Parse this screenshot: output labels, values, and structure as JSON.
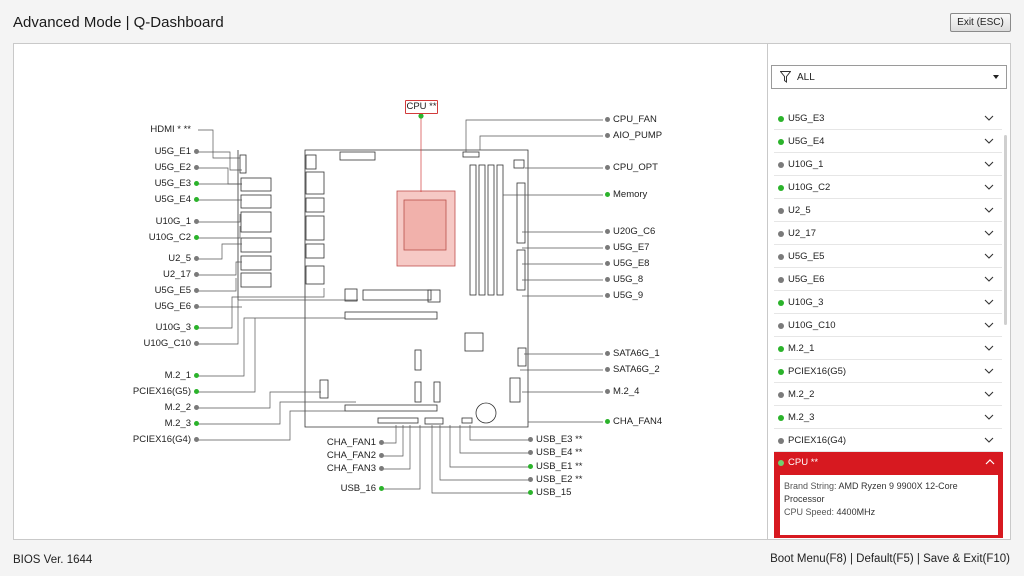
{
  "header": {
    "title": "Advanced Mode | Q-Dashboard",
    "exit_label": "Exit (ESC)"
  },
  "board": {
    "cpu_tag": "CPU **",
    "left_labels": [
      {
        "text": "HDMI * **",
        "status": "none"
      },
      {
        "text": "U5G_E1",
        "status": "grey"
      },
      {
        "text": "U5G_E2",
        "status": "grey"
      },
      {
        "text": "U5G_E3",
        "status": "green"
      },
      {
        "text": "U5G_E4",
        "status": "green"
      },
      {
        "text": "U10G_1",
        "status": "grey"
      },
      {
        "text": "U10G_C2",
        "status": "green"
      },
      {
        "text": "U2_5",
        "status": "grey"
      },
      {
        "text": "U2_17",
        "status": "grey"
      },
      {
        "text": "U5G_E5",
        "status": "grey"
      },
      {
        "text": "U5G_E6",
        "status": "grey"
      },
      {
        "text": "U10G_3",
        "status": "green"
      },
      {
        "text": "U10G_C10",
        "status": "grey"
      },
      {
        "text": "M.2_1",
        "status": "green"
      },
      {
        "text": "PCIEX16(G5)",
        "status": "green"
      },
      {
        "text": "M.2_2",
        "status": "grey"
      },
      {
        "text": "M.2_3",
        "status": "green"
      },
      {
        "text": "PCIEX16(G4)",
        "status": "grey"
      }
    ],
    "right_labels": [
      {
        "text": "CPU_FAN",
        "status": "grey"
      },
      {
        "text": "AIO_PUMP",
        "status": "grey"
      },
      {
        "text": "CPU_OPT",
        "status": "grey"
      },
      {
        "text": "Memory",
        "status": "green"
      },
      {
        "text": "U20G_C6",
        "status": "grey"
      },
      {
        "text": "U5G_E7",
        "status": "grey"
      },
      {
        "text": "U5G_E8",
        "status": "grey"
      },
      {
        "text": "U5G_8",
        "status": "grey"
      },
      {
        "text": "U5G_9",
        "status": "grey"
      },
      {
        "text": "SATA6G_1",
        "status": "grey"
      },
      {
        "text": "SATA6G_2",
        "status": "grey"
      },
      {
        "text": "M.2_4",
        "status": "grey"
      },
      {
        "text": "CHA_FAN4",
        "status": "green"
      }
    ],
    "bottom_left_labels": [
      {
        "text": "CHA_FAN1",
        "status": "grey"
      },
      {
        "text": "CHA_FAN2",
        "status": "grey"
      },
      {
        "text": "CHA_FAN3",
        "status": "grey"
      },
      {
        "text": "USB_16",
        "status": "green"
      }
    ],
    "bottom_right_labels": [
      {
        "text": "USB_E3 **",
        "status": "grey"
      },
      {
        "text": "USB_E4 **",
        "status": "grey"
      },
      {
        "text": "USB_E1 **",
        "status": "green"
      },
      {
        "text": "USB_E2 **",
        "status": "grey"
      },
      {
        "text": "USB_15",
        "status": "green"
      }
    ]
  },
  "panel": {
    "filter_label": "ALL",
    "items": [
      {
        "label": "U5G_E3",
        "status": "green"
      },
      {
        "label": "U5G_E4",
        "status": "green"
      },
      {
        "label": "U10G_1",
        "status": "grey"
      },
      {
        "label": "U10G_C2",
        "status": "green"
      },
      {
        "label": "U2_5",
        "status": "grey"
      },
      {
        "label": "U2_17",
        "status": "grey"
      },
      {
        "label": "U5G_E5",
        "status": "grey"
      },
      {
        "label": "U5G_E6",
        "status": "grey"
      },
      {
        "label": "U10G_3",
        "status": "green"
      },
      {
        "label": "U10G_C10",
        "status": "grey"
      },
      {
        "label": "M.2_1",
        "status": "green"
      },
      {
        "label": "PCIEX16(G5)",
        "status": "green"
      },
      {
        "label": "M.2_2",
        "status": "grey"
      },
      {
        "label": "M.2_3",
        "status": "green"
      },
      {
        "label": "PCIEX16(G4)",
        "status": "grey"
      }
    ],
    "expanded": {
      "label": "CPU **",
      "brand_key": "Brand String:",
      "brand_value": "AMD Ryzen 9 9900X 12-Core Processor",
      "speed_key": "CPU Speed:",
      "speed_value": "4400MHz"
    }
  },
  "footer": {
    "bios_version": "BIOS Ver. 1644",
    "boot_menu": "Boot Menu(F8)",
    "default": "Default(F5)",
    "save_exit": "Save & Exit(F10)",
    "separator": " | "
  },
  "colors": {
    "green": "#2bb32b",
    "grey": "#7a7a7a",
    "accent_red": "#d71920"
  }
}
